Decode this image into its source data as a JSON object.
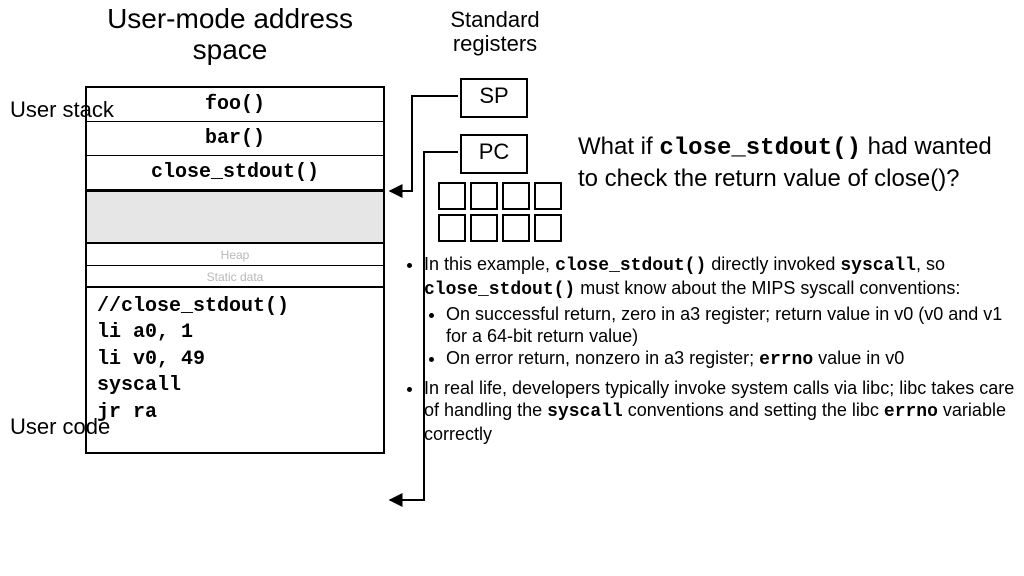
{
  "titles": {
    "address_space": "User-mode address space",
    "registers": "Standard registers"
  },
  "labels": {
    "user_stack": "User stack",
    "user_code": "User code"
  },
  "stack": {
    "frame0": "foo()",
    "frame1": "bar()",
    "frame2": "close_stdout()"
  },
  "segments": {
    "heap": "Heap",
    "static": "Static data"
  },
  "code": {
    "l0": "//close_stdout()",
    "l1": "li a0, 1",
    "l2": "li v0, 49",
    "l3": "syscall",
    "l4": "jr ra"
  },
  "registers": {
    "sp": "SP",
    "pc": "PC"
  },
  "question": {
    "pre": "What if ",
    "fn": "close_stdout()",
    "post": " had wanted to check the return value of close()?"
  },
  "bullets": {
    "b1_pre": "In this example, ",
    "b1_fn1": "close_stdout()",
    "b1_mid": " directly invoked ",
    "b1_sys": "syscall",
    "b1_mid2": ", so ",
    "b1_fn2": "close_stdout()",
    "b1_post": " must know about the MIPS syscall conventions:",
    "b1a": "On successful return, zero in a3 register; return value in v0 (v0 and v1 for a 64-bit return value)",
    "b1b_pre": "On error return, nonzero in a3 register; ",
    "b1b_errno": "errno",
    "b1b_post": " value in v0",
    "b2_pre": "In real life, developers typically invoke system calls via libc; libc takes care of handling the ",
    "b2_sys": "syscall",
    "b2_mid": " conventions and setting the libc ",
    "b2_errno": "errno",
    "b2_post": " variable correctly"
  }
}
